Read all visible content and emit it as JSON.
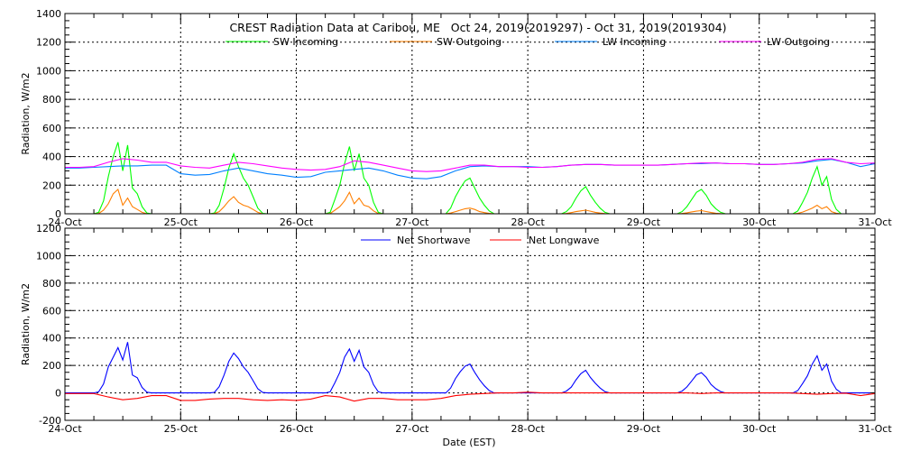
{
  "chart_data": [
    {
      "type": "line",
      "title": "CREST Radiation Data at Caribou, ME   Oct 24, 2019(2019297) - Oct 31, 2019(2019304)",
      "xlabel": "",
      "ylabel": "Radiation, W/m2",
      "ylim": [
        0,
        1400
      ],
      "yticks": [
        0,
        200,
        400,
        600,
        800,
        1000,
        1200,
        1400
      ],
      "xlim_hours": [
        0,
        168
      ],
      "xtick_labels": [
        "24-Oct",
        "25-Oct",
        "26-Oct",
        "27-Oct",
        "28-Oct",
        "29-Oct",
        "30-Oct",
        "31-Oct"
      ],
      "grid": true,
      "legend_position": "top-center",
      "series": [
        {
          "name": "SW Incoming",
          "color": "#00ff00",
          "step_hours": 1,
          "values": [
            0,
            0,
            0,
            0,
            0,
            0,
            0,
            10,
            90,
            260,
            400,
            500,
            300,
            480,
            180,
            140,
            50,
            5,
            0,
            0,
            0,
            0,
            0,
            0,
            0,
            0,
            0,
            0,
            0,
            0,
            0,
            5,
            60,
            180,
            320,
            420,
            330,
            250,
            200,
            120,
            40,
            3,
            0,
            0,
            0,
            0,
            0,
            0,
            0,
            0,
            0,
            0,
            0,
            0,
            0,
            10,
            100,
            200,
            350,
            470,
            300,
            420,
            250,
            200,
            80,
            10,
            0,
            0,
            0,
            0,
            0,
            0,
            0,
            0,
            0,
            0,
            0,
            0,
            0,
            0,
            40,
            120,
            180,
            230,
            250,
            180,
            110,
            60,
            20,
            0,
            0,
            0,
            0,
            0,
            0,
            0,
            0,
            0,
            0,
            0,
            0,
            0,
            0,
            0,
            15,
            50,
            110,
            160,
            190,
            130,
            80,
            40,
            10,
            0,
            0,
            0,
            0,
            0,
            0,
            0,
            0,
            0,
            0,
            0,
            0,
            0,
            0,
            0,
            15,
            50,
            100,
            150,
            170,
            130,
            70,
            35,
            10,
            0,
            0,
            0,
            0,
            0,
            0,
            0,
            0,
            0,
            0,
            0,
            0,
            0,
            0,
            0,
            20,
            80,
            150,
            250,
            330,
            200,
            260,
            100,
            30,
            0,
            0,
            0,
            0,
            0,
            0,
            0
          ]
        },
        {
          "name": "SW Outgoing",
          "color": "#ff7f00",
          "step_hours": 1,
          "values": [
            0,
            0,
            0,
            0,
            0,
            0,
            0,
            2,
            25,
            70,
            140,
            170,
            60,
            110,
            50,
            30,
            10,
            0,
            0,
            0,
            0,
            0,
            0,
            0,
            0,
            0,
            0,
            0,
            0,
            0,
            0,
            1,
            15,
            50,
            90,
            120,
            80,
            60,
            50,
            30,
            10,
            0,
            0,
            0,
            0,
            0,
            0,
            0,
            0,
            0,
            0,
            0,
            0,
            0,
            0,
            2,
            25,
            50,
            90,
            150,
            70,
            110,
            60,
            50,
            20,
            2,
            0,
            0,
            0,
            0,
            0,
            0,
            0,
            0,
            0,
            0,
            0,
            0,
            0,
            0,
            5,
            15,
            25,
            35,
            40,
            30,
            15,
            8,
            3,
            0,
            0,
            0,
            0,
            0,
            0,
            0,
            0,
            0,
            0,
            0,
            0,
            0,
            0,
            0,
            2,
            8,
            15,
            20,
            25,
            18,
            10,
            5,
            1,
            0,
            0,
            0,
            0,
            0,
            0,
            0,
            0,
            0,
            0,
            0,
            0,
            0,
            0,
            0,
            2,
            7,
            13,
            18,
            22,
            16,
            9,
            4,
            1,
            0,
            0,
            0,
            0,
            0,
            0,
            0,
            0,
            0,
            0,
            0,
            0,
            0,
            0,
            0,
            3,
            12,
            25,
            40,
            60,
            35,
            50,
            15,
            4,
            0,
            0,
            0,
            0,
            0,
            0,
            0
          ]
        },
        {
          "name": "LW Incoming",
          "color": "#0080ff",
          "step_hours": 3,
          "values": [
            320,
            320,
            325,
            330,
            335,
            335,
            340,
            340,
            280,
            270,
            275,
            300,
            320,
            300,
            280,
            270,
            255,
            260,
            290,
            300,
            310,
            320,
            300,
            270,
            250,
            245,
            260,
            300,
            330,
            335,
            330,
            330,
            330,
            325,
            330,
            340,
            345,
            345,
            340,
            340,
            340,
            340,
            345,
            350,
            350,
            355,
            350,
            350,
            345,
            345,
            350,
            355,
            370,
            380,
            360,
            330,
            350
          ]
        },
        {
          "name": "LW Outgoing",
          "color": "#ff00ff",
          "step_hours": 3,
          "values": [
            325,
            325,
            330,
            360,
            385,
            375,
            360,
            360,
            335,
            325,
            320,
            340,
            360,
            350,
            335,
            320,
            310,
            305,
            310,
            330,
            370,
            360,
            340,
            320,
            300,
            295,
            300,
            320,
            340,
            340,
            330,
            330,
            325,
            325,
            330,
            340,
            345,
            345,
            340,
            340,
            340,
            340,
            345,
            350,
            355,
            355,
            350,
            350,
            345,
            345,
            350,
            360,
            380,
            385,
            360,
            350,
            355
          ]
        }
      ]
    },
    {
      "type": "line",
      "xlabel": "Date (EST)",
      "ylabel": "Radiation, W/m2",
      "ylim": [
        -200,
        1200
      ],
      "yticks": [
        -200,
        0,
        200,
        400,
        600,
        800,
        1000,
        1200
      ],
      "xlim_hours": [
        0,
        168
      ],
      "xtick_labels": [
        "24-Oct",
        "25-Oct",
        "26-Oct",
        "27-Oct",
        "28-Oct",
        "29-Oct",
        "30-Oct",
        "31-Oct"
      ],
      "grid": true,
      "legend_position": "top-center",
      "series": [
        {
          "name": "Net Shortwave",
          "color": "#0000ff",
          "step_hours": 1,
          "values": [
            0,
            0,
            0,
            0,
            0,
            0,
            0,
            8,
            65,
            190,
            260,
            330,
            240,
            370,
            130,
            110,
            40,
            5,
            0,
            0,
            0,
            0,
            0,
            0,
            0,
            0,
            0,
            0,
            0,
            0,
            0,
            4,
            45,
            130,
            230,
            290,
            250,
            190,
            150,
            90,
            30,
            3,
            0,
            0,
            0,
            0,
            0,
            0,
            0,
            0,
            0,
            0,
            0,
            0,
            0,
            8,
            75,
            150,
            260,
            320,
            230,
            310,
            190,
            150,
            60,
            8,
            0,
            0,
            0,
            0,
            0,
            0,
            0,
            0,
            0,
            0,
            0,
            0,
            0,
            0,
            35,
            105,
            155,
            195,
            210,
            150,
            95,
            52,
            17,
            0,
            0,
            0,
            0,
            0,
            0,
            0,
            0,
            0,
            0,
            0,
            0,
            0,
            0,
            0,
            13,
            42,
            95,
            140,
            165,
            112,
            70,
            35,
            9,
            0,
            0,
            0,
            0,
            0,
            0,
            0,
            0,
            0,
            0,
            0,
            0,
            0,
            0,
            0,
            13,
            43,
            87,
            132,
            148,
            114,
            61,
            31,
            9,
            0,
            0,
            0,
            0,
            0,
            0,
            0,
            0,
            0,
            0,
            0,
            0,
            0,
            0,
            0,
            17,
            68,
            125,
            210,
            270,
            165,
            210,
            85,
            26,
            0,
            0,
            0,
            0,
            0,
            0,
            0
          ]
        },
        {
          "name": "Net Longwave",
          "color": "#ff0000",
          "step_hours": 3,
          "values": [
            -5,
            -5,
            -5,
            -30,
            -50,
            -40,
            -20,
            -20,
            -55,
            -55,
            -45,
            -40,
            -40,
            -50,
            -55,
            -50,
            -55,
            -45,
            -20,
            -30,
            -60,
            -40,
            -40,
            -50,
            -50,
            -50,
            -40,
            -20,
            -10,
            -5,
            0,
            0,
            5,
            0,
            0,
            0,
            0,
            0,
            0,
            0,
            0,
            0,
            0,
            0,
            -5,
            0,
            0,
            0,
            0,
            0,
            0,
            -5,
            -10,
            -5,
            -2,
            -20,
            -5
          ]
        }
      ]
    }
  ]
}
